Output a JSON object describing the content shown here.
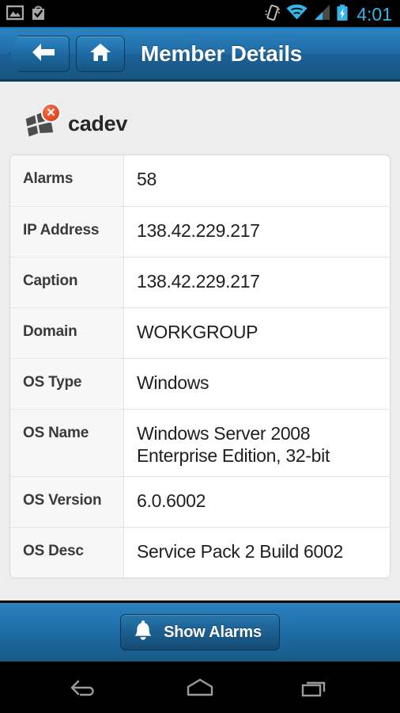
{
  "statusbar": {
    "time": "4:01",
    "left_icons": [
      "photo-icon",
      "shopping-bag-check-icon"
    ],
    "right_icons": [
      "vibrate-icon",
      "wifi-icon",
      "cell-signal-icon",
      "battery-charging-icon"
    ],
    "accent_color": "#33b5e5",
    "background_color": "#000000"
  },
  "header": {
    "title": "Member Details",
    "back_label": "back-arrow-icon",
    "home_label": "home-icon",
    "background_start": "#2b84c0",
    "background_end": "#17567f"
  },
  "device": {
    "name": "cadev",
    "icon": "windows-logo-icon",
    "status_badge": "error-x-badge",
    "badge_color": "#e8431f"
  },
  "details": {
    "rows": [
      {
        "label": "Alarms",
        "value": "58"
      },
      {
        "label": "IP Address",
        "value": "138.42.229.217"
      },
      {
        "label": "Caption",
        "value": "138.42.229.217"
      },
      {
        "label": "Domain",
        "value": "WORKGROUP"
      },
      {
        "label": "OS Type",
        "value": "Windows"
      },
      {
        "label": "OS Name",
        "value": "Windows Server 2008 Enterprise Edition, 32-bit"
      },
      {
        "label": "OS Version",
        "value": "6.0.6002"
      },
      {
        "label": "OS Desc",
        "value": "Service Pack 2 Build 6002"
      }
    ]
  },
  "bottombar": {
    "show_alarms_label": "Show Alarms",
    "show_alarms_icon": "bell-icon"
  },
  "navbar": {
    "back_label": "android-back-icon",
    "home_label": "android-home-icon",
    "recents_label": "android-recents-icon",
    "icon_color": "#9b9b9b"
  }
}
